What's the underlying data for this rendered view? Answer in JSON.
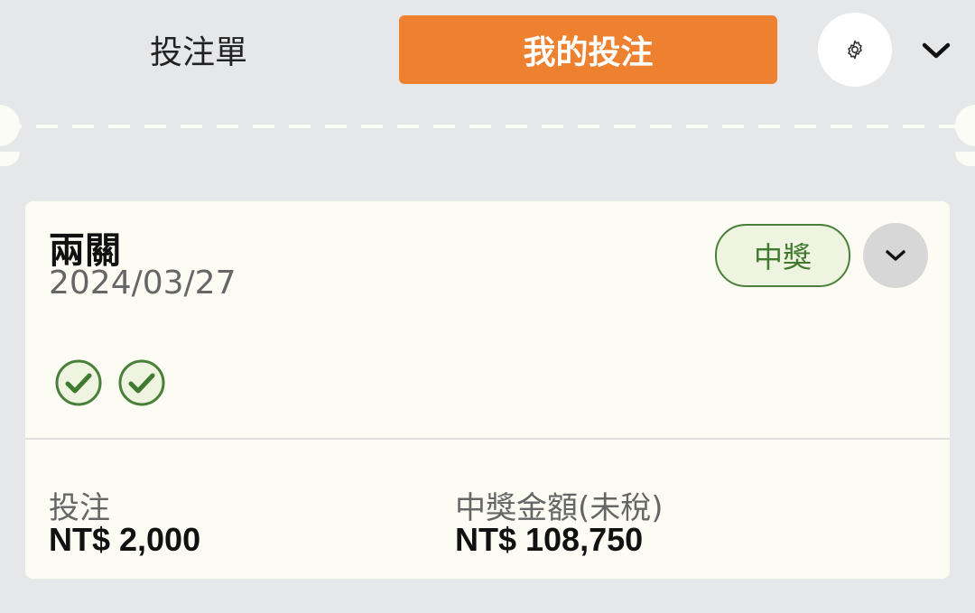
{
  "header": {
    "tab_betslip": "投注單",
    "tab_mybets": "我的投注",
    "settings_icon": "gear-icon",
    "collapse_icon": "chevron-down-icon"
  },
  "bet": {
    "type": "兩關",
    "date": "2024/03/27",
    "status": "中獎",
    "legs": [
      {
        "result": "won",
        "icon": "check-circle-icon"
      },
      {
        "result": "won",
        "icon": "check-circle-icon"
      }
    ],
    "stake_label": "投注",
    "stake_value": "NT$ 2,000",
    "winnings_label": "中獎金額(未稅)",
    "winnings_value": "NT$ 108,750"
  },
  "colors": {
    "accent": "#ee8130",
    "background": "#e6e7e9",
    "card": "#fcfcf5",
    "win_green": "#3f7a2e",
    "win_badge_bg": "#eef4e0"
  }
}
